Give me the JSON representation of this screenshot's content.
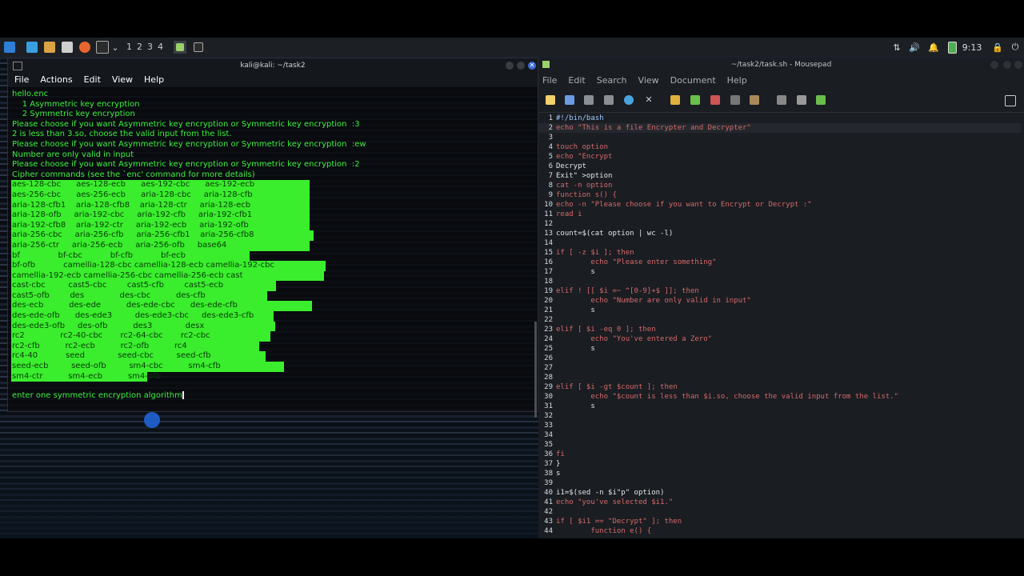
{
  "taskbar": {
    "workspaces": [
      "1",
      "2",
      "3",
      "4"
    ],
    "clock": "9:13"
  },
  "terminal": {
    "title": "kali@kali: ~/task2",
    "menu": [
      "File",
      "Actions",
      "Edit",
      "View",
      "Help"
    ],
    "lines": [
      "hello.enc",
      "    1 Asymmetric key encryption",
      "    2 Symmetric key encryption",
      "Please choose if you want Asymmetric key encryption or Symmetric key encryption  :3",
      "2 is less than 3.so, choose the valid input from the list.",
      "Please choose if you want Asymmetric key encryption or Symmetric key encryption  :ew",
      "Number are only valid in input",
      "Please choose if you want Asymmetric key encryption or Symmetric key encryption  :2",
      "Cipher commands (see the `enc' command for more details)"
    ],
    "cipher_lines": [
      "aes-128-cbc      aes-128-ecb      aes-192-cbc      aes-192-ecb",
      "aes-256-cbc      aes-256-ecb      aria-128-cbc     aria-128-cfb",
      "aria-128-cfb1    aria-128-cfb8    aria-128-ctr     aria-128-ecb",
      "aria-128-ofb     aria-192-cbc     aria-192-cfb     aria-192-cfb1",
      "aria-192-cfb8    aria-192-ctr     aria-192-ecb     aria-192-ofb",
      "aria-256-cbc     aria-256-cfb     aria-256-cfb1    aria-256-cfb8",
      "aria-256-ctr     aria-256-ecb     aria-256-ofb     base64",
      "bf               bf-cbc           bf-cfb           bf-ecb",
      "bf-ofb           camellia-128-cbc camellia-128-ecb camellia-192-cbc",
      "camellia-192-ecb camellia-256-cbc camellia-256-ecb cast",
      "cast-cbc         cast5-cbc        cast5-cfb        cast5-ecb",
      "cast5-ofb        des              des-cbc          des-cfb",
      "des-ecb          des-ede          des-ede-cbc      des-ede-cfb",
      "des-ede-ofb      des-ede3         des-ede3-cbc     des-ede3-cfb",
      "des-ede3-ofb     des-ofb          des3             desx",
      "rc2              rc2-40-cbc       rc2-64-cbc       rc2-cbc",
      "rc2-cfb          rc2-ecb          rc2-ofb          rc4",
      "rc4-40           seed             seed-cbc         seed-cfb",
      "seed-ecb         seed-ofb         sm4-cbc          sm4-cfb",
      "sm4-ctr          sm4-ecb          sm4-ofb"
    ],
    "prompt": "enter one symmetric encryption algorithm"
  },
  "editor": {
    "title": "~/task2/task.sh - Mousepad",
    "menu": [
      "File",
      "Edit",
      "Search",
      "View",
      "Document",
      "Help"
    ],
    "lines": [
      {
        "n": "1",
        "t": "#!/bin/bash"
      },
      {
        "n": "2",
        "t": "echo \"This is a file Encrypter and Decrypter\""
      },
      {
        "n": "3",
        "t": ""
      },
      {
        "n": "4",
        "t": "touch option"
      },
      {
        "n": "5",
        "t": "echo \"Encrypt"
      },
      {
        "n": "6",
        "t": "Decrypt"
      },
      {
        "n": "7",
        "t": "Exit\" >option"
      },
      {
        "n": "8",
        "t": "cat -n option"
      },
      {
        "n": "9",
        "t": "function s() {"
      },
      {
        "n": "10",
        "t": "echo -n \"Please choose if you want to Encrypt or Decrypt :\""
      },
      {
        "n": "11",
        "t": "read i"
      },
      {
        "n": "12",
        "t": ""
      },
      {
        "n": "13",
        "t": "count=$(cat option | wc -l)"
      },
      {
        "n": "14",
        "t": ""
      },
      {
        "n": "15",
        "t": "if [ -z $i ]; then"
      },
      {
        "n": "16",
        "t": "        echo \"Please enter something\""
      },
      {
        "n": "17",
        "t": "        s"
      },
      {
        "n": "18",
        "t": ""
      },
      {
        "n": "19",
        "t": "elif ! [[ $i =~ ^[0-9]+$ ]]; then"
      },
      {
        "n": "20",
        "t": "        echo \"Number are only valid in input\""
      },
      {
        "n": "21",
        "t": "        s"
      },
      {
        "n": "22",
        "t": ""
      },
      {
        "n": "23",
        "t": "elif [ $i -eq 0 ]; then"
      },
      {
        "n": "24",
        "t": "        echo \"You've entered a Zero\""
      },
      {
        "n": "25",
        "t": "        s"
      },
      {
        "n": "26",
        "t": ""
      },
      {
        "n": "27",
        "t": ""
      },
      {
        "n": "28",
        "t": ""
      },
      {
        "n": "29",
        "t": "elif [ $i -gt $count ]; then"
      },
      {
        "n": "30",
        "t": "        echo \"$count is less than $i.so, choose the valid input from the list.\""
      },
      {
        "n": "31",
        "t": "        s"
      },
      {
        "n": "32",
        "t": ""
      },
      {
        "n": "33",
        "t": ""
      },
      {
        "n": "34",
        "t": ""
      },
      {
        "n": "35",
        "t": ""
      },
      {
        "n": "36",
        "t": "fi"
      },
      {
        "n": "37",
        "t": "}"
      },
      {
        "n": "38",
        "t": "s"
      },
      {
        "n": "39",
        "t": ""
      },
      {
        "n": "40",
        "t": "i1=$(sed -n $i\"p\" option)"
      },
      {
        "n": "41",
        "t": "echo \"you've selected $i1.\""
      },
      {
        "n": "42",
        "t": ""
      },
      {
        "n": "43",
        "t": "if [ $i1 == \"Decrypt\" ]; then"
      },
      {
        "n": "44",
        "t": "        function e() {"
      }
    ]
  }
}
